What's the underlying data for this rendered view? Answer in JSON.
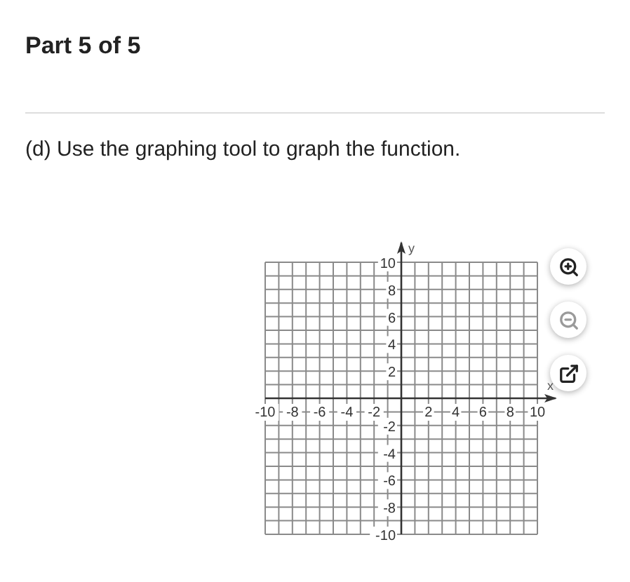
{
  "part_title": "Part 5 of 5",
  "question": "(d) Use the graphing tool to graph the function.",
  "graph": {
    "x_axis_label": "x",
    "y_axis_label": "y",
    "x_tick_labels": [
      "-10",
      "-8",
      "-6",
      "-4",
      "-2",
      "2",
      "4",
      "6",
      "8",
      "10"
    ],
    "y_tick_labels": [
      "10",
      "8",
      "6",
      "4",
      "2",
      "-2",
      "-4",
      "-6",
      "-8",
      "-10"
    ]
  },
  "tools": [
    {
      "kind": "zoom_in",
      "disabled": false
    },
    {
      "kind": "zoom_out",
      "disabled": true
    },
    {
      "kind": "open_external",
      "disabled": false
    }
  ]
}
